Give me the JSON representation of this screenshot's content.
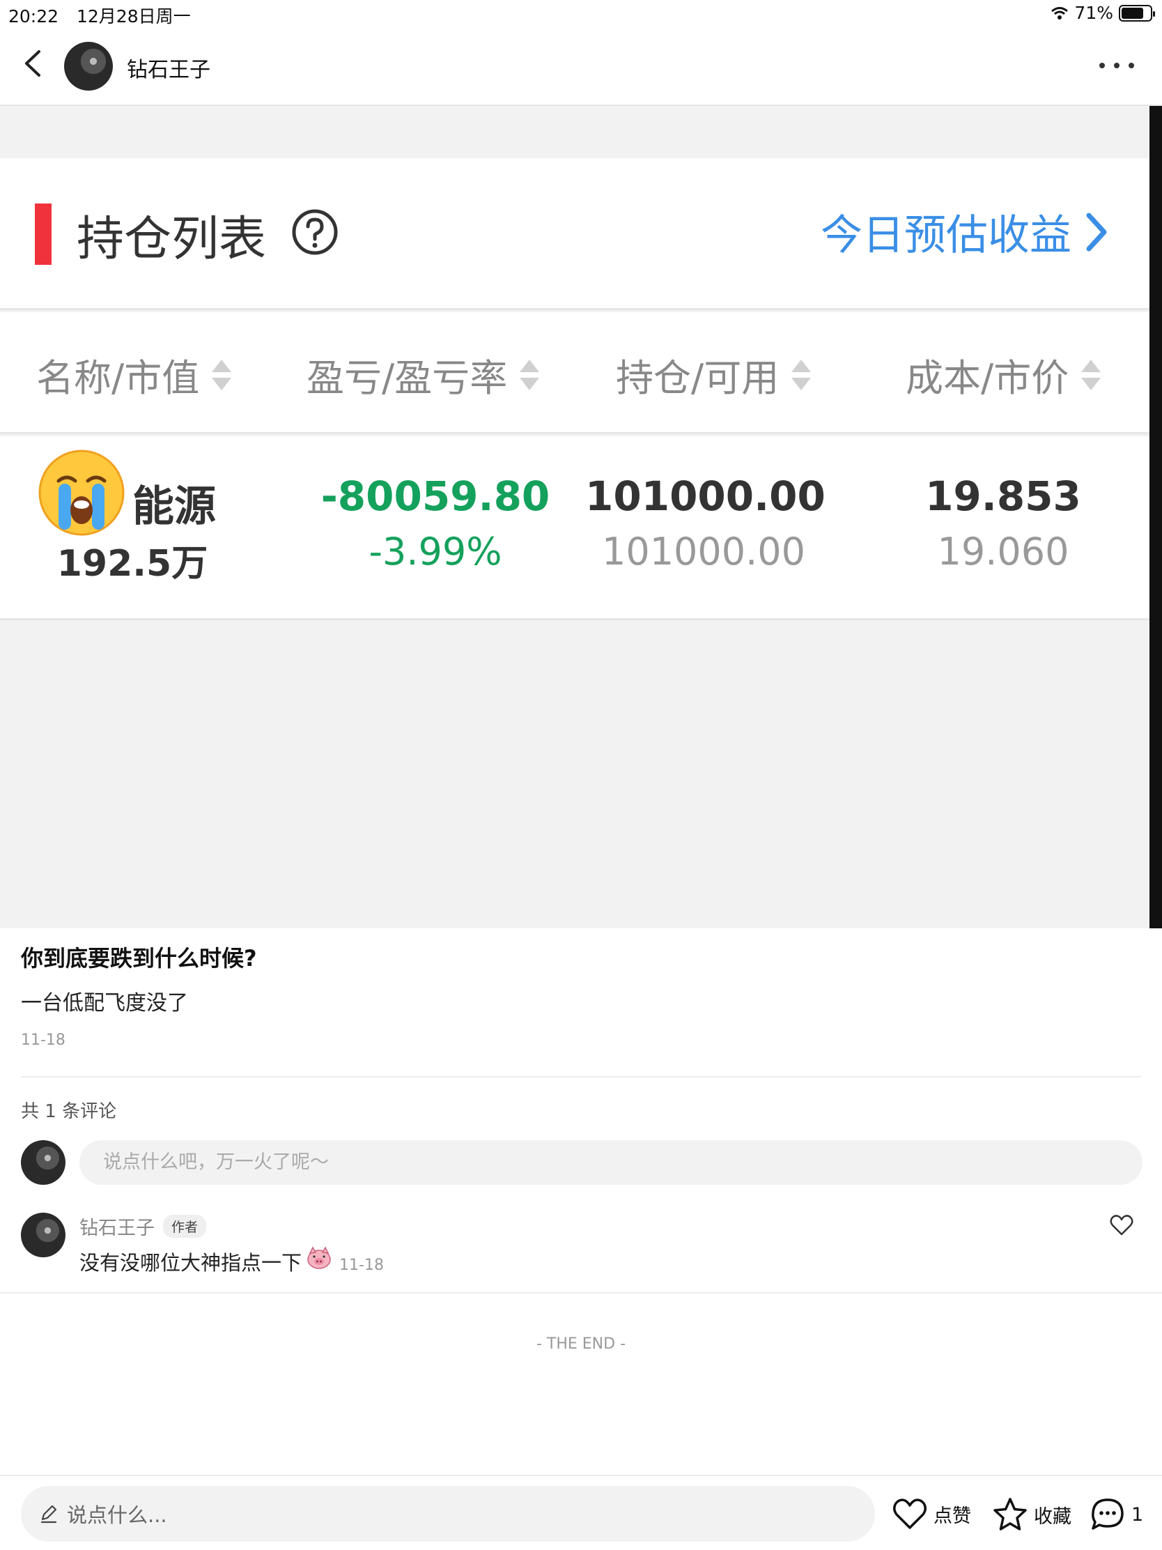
{
  "status_bar": {
    "time": "20:22",
    "date": "12月28日周一",
    "battery": "71%"
  },
  "header": {
    "author_name": "钻石王子"
  },
  "screenshot": {
    "title": "持仓列表",
    "today_link": "今日预估收益",
    "columns": [
      "名称/市值",
      "盈亏/盈亏率",
      "持仓/可用",
      "成本/市价"
    ],
    "row": {
      "name_partial": "能源",
      "market_value": "192.5万",
      "profit": "-80059.80",
      "profit_rate": "-3.99%",
      "holding": "101000.00",
      "available": "101000.00",
      "cost": "19.853",
      "price": "19.060"
    }
  },
  "post": {
    "title": "你到底要跌到什么时候?",
    "body": "一台低配飞度没了",
    "date": "11-18"
  },
  "comments": {
    "count_label": "共 1 条评论",
    "input_placeholder": "说点什么吧，万一火了呢～",
    "items": [
      {
        "author": "钻石王子",
        "badge": "作者",
        "text": "没有没哪位大神指点一下",
        "date": "11-18"
      }
    ]
  },
  "end_label": "- THE END -",
  "bottom_bar": {
    "input_placeholder": "说点什么...",
    "like_label": "点赞",
    "collect_label": "收藏",
    "comment_count": "1"
  },
  "colors": {
    "accent_blue": "#3a8ee6",
    "red_bar": "#f0323c",
    "loss_green": "#14a15c"
  },
  "icons": [
    "back-icon",
    "more-icon",
    "help-icon",
    "chevron-right-icon",
    "sort-icon",
    "crying-emoji-icon",
    "pig-emoji-icon",
    "heart-icon",
    "star-icon",
    "comment-icon",
    "pencil-icon",
    "wifi-icon",
    "battery-icon"
  ]
}
